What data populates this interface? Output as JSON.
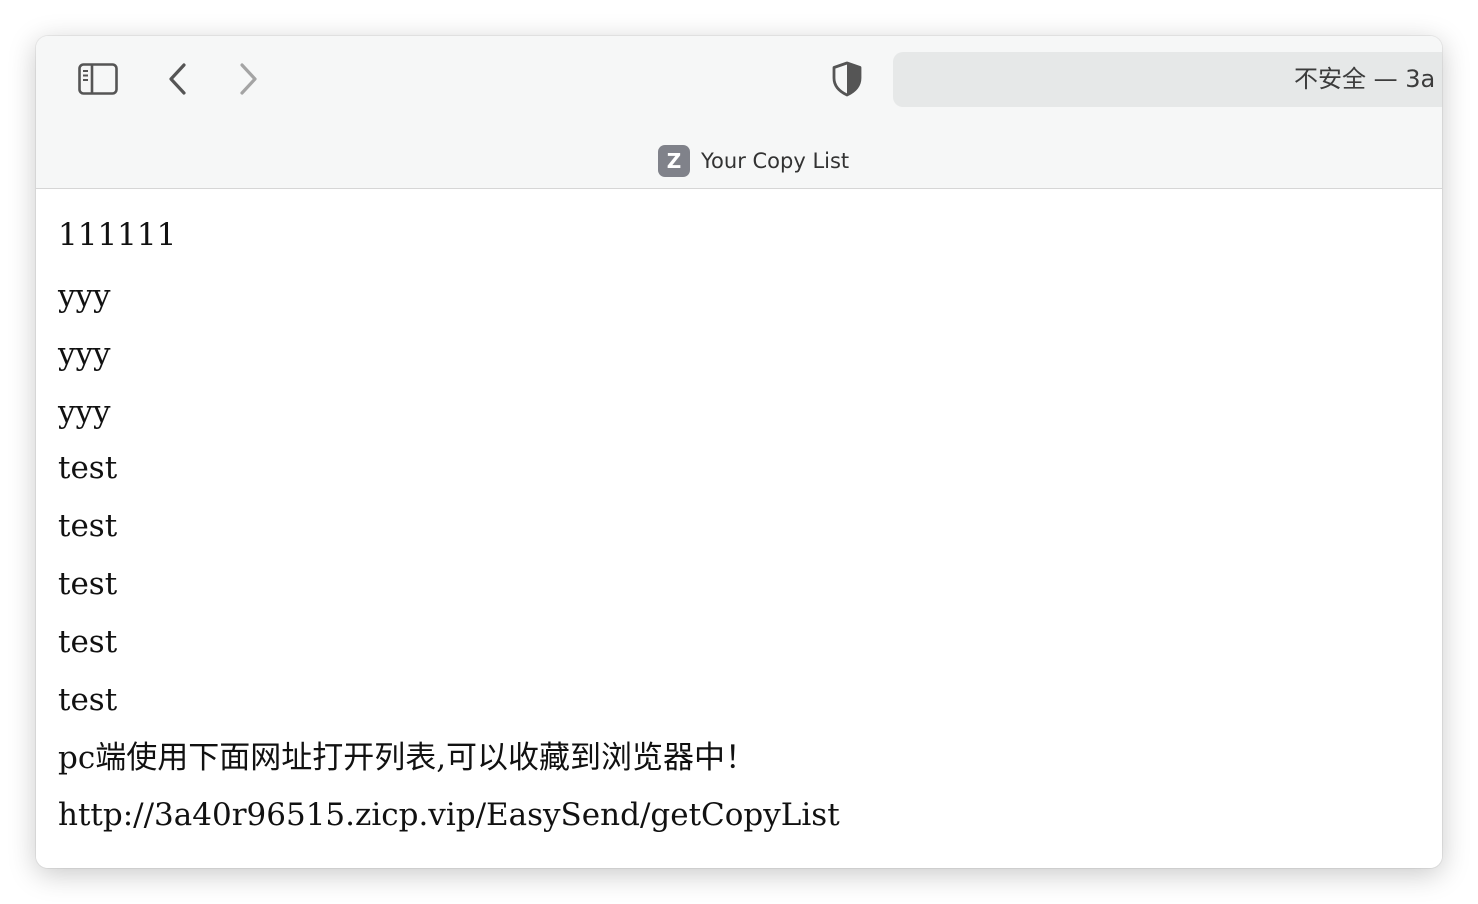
{
  "browser": {
    "address_text": "不安全 — 3a",
    "tab_favicon_letter": "Z",
    "tab_title": "Your Copy List",
    "icons": {
      "sidebar": "sidebar-icon",
      "back": "chevron-left-icon",
      "forward": "chevron-right-icon",
      "privacy": "shield-icon"
    }
  },
  "page": {
    "lines": [
      "111111",
      "yyy",
      "yyy",
      "yyy",
      "test",
      "test",
      "test",
      "test",
      "test",
      "pc端使用下面网址打开列表,可以收藏到浏览器中！",
      "http://3a40r96515.zicp.vip/EasySend/getCopyList"
    ]
  },
  "colors": {
    "toolbar_bg": "#f6f7f7",
    "address_bg": "#e6e8e8",
    "favicon_bg": "#80828a"
  }
}
